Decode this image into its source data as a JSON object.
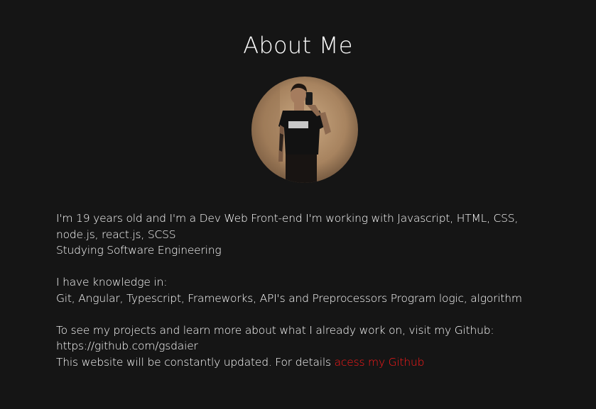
{
  "page": {
    "title": "About Me"
  },
  "bio": {
    "line1": "I'm 19 years old and I'm a Dev Web Front-end I'm working with Javascript, HTML, CSS,",
    "line2": "node.js, react.js, SCSS",
    "line3": "Studying Software Engineering",
    "knowledge_heading": "I have knowledge in:",
    "knowledge_list": "Git, Angular, Typescript, Frameworks, API's and Preprocessors Program logic, algorithm",
    "projects_line": "To see my projects and learn more about what I already work on, visit my Github:",
    "github_url": "https://github.com/gsdaier",
    "update_text": "This website will be constantly updated. For details ",
    "link_label": "acess my Github"
  },
  "colors": {
    "background": "#151515",
    "text": "#ffffff",
    "link": "#ff1a1a"
  },
  "icons": {
    "avatar": "profile-photo"
  }
}
